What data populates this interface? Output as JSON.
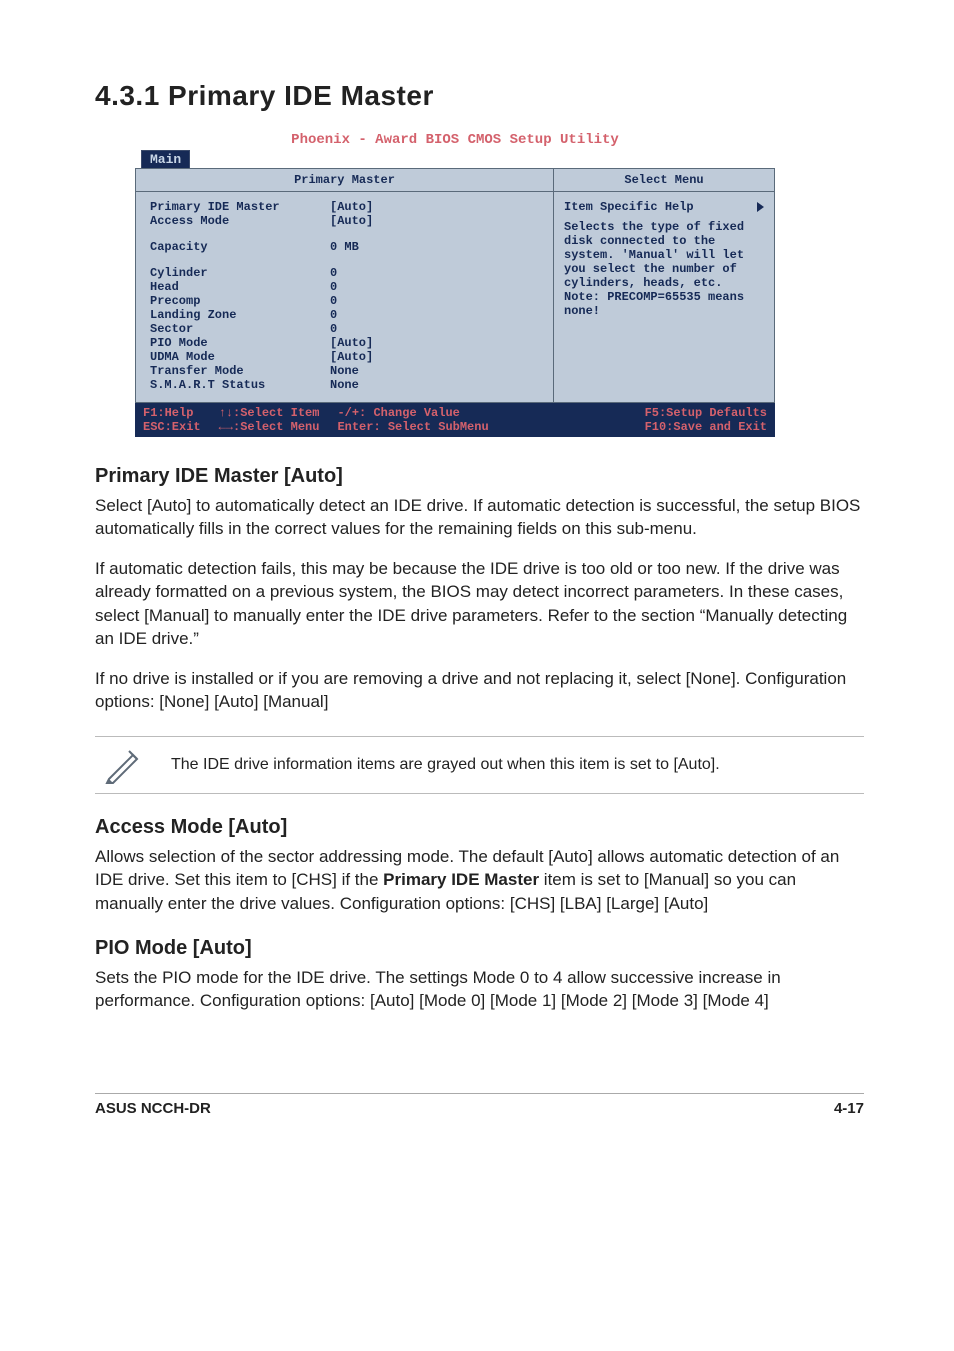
{
  "heading": "4.3.1   Primary IDE Master",
  "bios": {
    "title": "Phoenix - Award BIOS CMOS Setup Utility",
    "tab": "Main",
    "panel_title_left": "Primary Master",
    "panel_title_right": "Select Menu",
    "rows": [
      {
        "k": "Primary IDE Master",
        "v": "[Auto]"
      },
      {
        "k": "Access Mode",
        "v": "[Auto]"
      }
    ],
    "capacity": {
      "k": "Capacity",
      "v": "  0 MB"
    },
    "rows2": [
      {
        "k": "Cylinder",
        "v": "0"
      },
      {
        "k": "Head",
        "v": "0"
      },
      {
        "k": "Precomp",
        "v": "0"
      },
      {
        "k": "Landing Zone",
        "v": "0"
      },
      {
        "k": "Sector",
        "v": "0"
      },
      {
        "k": "PIO Mode",
        "v": "[Auto]"
      },
      {
        "k": "UDMA Mode",
        "v": "[Auto]"
      },
      {
        "k": "Transfer Mode",
        "v": "None"
      },
      {
        "k": "S.M.A.R.T Status",
        "v": "None"
      }
    ],
    "help_title": "Item Specific Help",
    "help_body": "Selects the type of fixed disk connected to the system. 'Manual' will let you select the number of cylinders, heads, etc.\nNote: PRECOMP=65535 means none!",
    "footer": {
      "c1a": "F1:Help",
      "c1b": "ESC:Exit",
      "c2a": "↑↓:Select Item",
      "c2b": "←→:Select Menu",
      "c3a": "-/+: Change Value",
      "c3b": "Enter: Select SubMenu",
      "c4a": "F5:Setup Defaults",
      "c4b": "F10:Save and Exit"
    }
  },
  "sec1": {
    "h": "Primary IDE Master [Auto]",
    "p1": "Select [Auto] to automatically detect an IDE drive. If automatic detection is successful, the setup BIOS automatically fills in the correct values for the remaining fields on this sub-menu.",
    "p2": "If automatic detection fails, this may be because the IDE drive is too old or too new. If the drive was already formatted on a previous system, the BIOS may detect incorrect parameters. In these cases, select [Manual] to manually enter the IDE drive parameters. Refer to the section “Manually detecting an IDE drive.”",
    "p3": "If no drive is installed or if you are removing a drive and not replacing it, select [None]. Configuration options: [None] [Auto] [Manual]"
  },
  "note": "The IDE drive information items are grayed out when this item is set to [Auto].",
  "sec2": {
    "h": "Access Mode [Auto]",
    "p_pre": "Allows selection of the sector addressing mode. The default [Auto] allows automatic detection of an IDE drive. Set this item to [CHS] if the ",
    "bold": "Primary IDE Master",
    "p_post": " item is set to [Manual] so you can manually enter the drive values. Configuration options: [CHS] [LBA] [Large] [Auto]"
  },
  "sec3": {
    "h": "PIO Mode [Auto]",
    "p": "Sets the PIO mode for the IDE drive. The settings Mode 0 to 4 allow successive increase in performance. Configuration options: [Auto] [Mode 0] [Mode 1] [Mode 2] [Mode 3] [Mode 4]"
  },
  "footer_left": "ASUS NCCH-DR",
  "footer_right": "4-17"
}
